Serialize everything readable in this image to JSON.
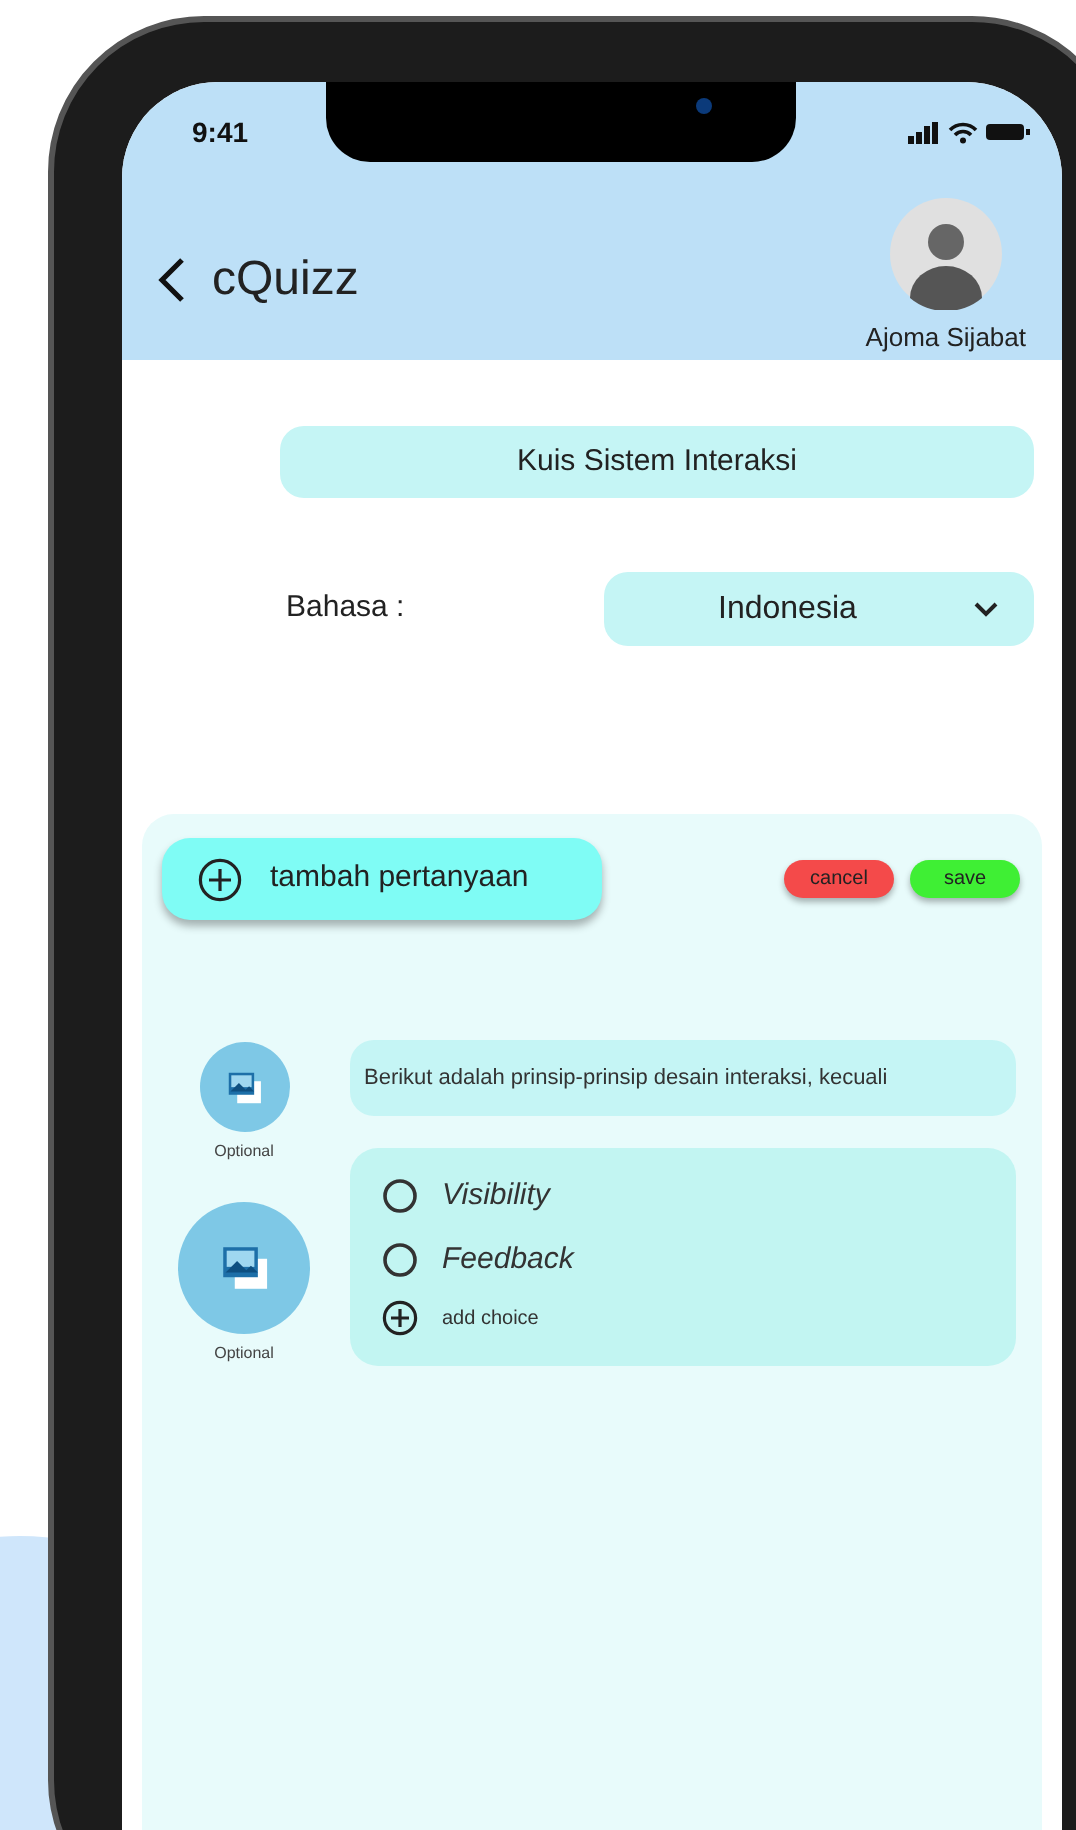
{
  "status_bar": {
    "time": "9:41"
  },
  "header": {
    "title": "cQuizz",
    "user_name": "Ajoma Sijabat"
  },
  "quiz_title": {
    "value": "Kuis Sistem Interaksi"
  },
  "language": {
    "label": "Bahasa :",
    "value": "Indonesia"
  },
  "toolbar": {
    "add_question": "tambah pertanyaan",
    "buttons": [
      {
        "kind": "cancel",
        "label": "cancel"
      },
      {
        "kind": "save",
        "label": "save"
      }
    ]
  },
  "question": {
    "image_labels": [
      "Optional",
      "Optional"
    ],
    "text": "Berikut adalah prinsip-prinsip desain interaksi, kecuali",
    "choices": [
      {
        "label": "Visibility",
        "selected": false
      },
      {
        "label": "Feedback",
        "selected": false
      }
    ],
    "add_choice": "add choice"
  }
}
